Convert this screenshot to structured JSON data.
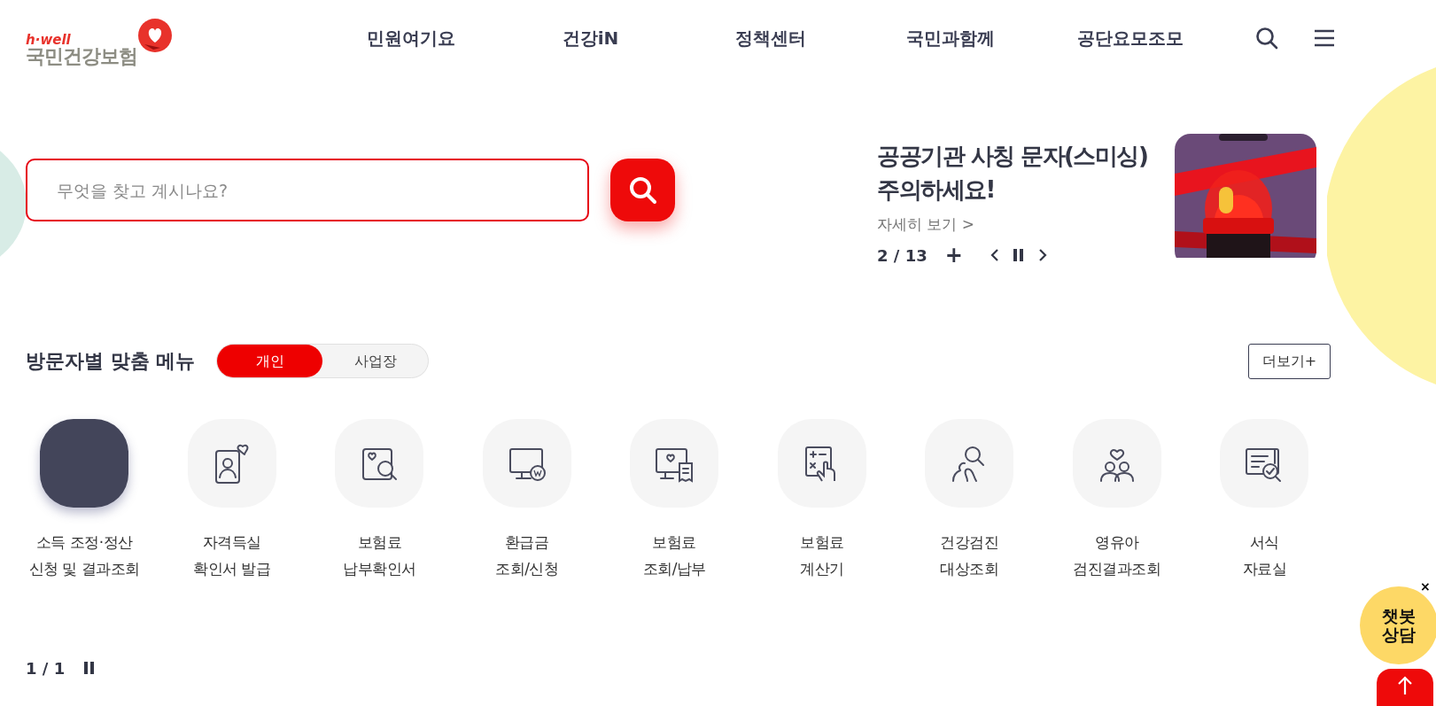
{
  "logo": {
    "tagline": "h·well",
    "name": "국민건강보험"
  },
  "nav": [
    "민원여기요",
    "건강iN",
    "정책센터",
    "국민과함께",
    "공단요모조모"
  ],
  "search": {
    "placeholder": "무엇을 찾고 계시나요?"
  },
  "banner": {
    "title": "공공기관 사칭 문자(스미싱)\n주의하세요!",
    "link": "자세히 보기 >",
    "current": "2",
    "separator": "/",
    "total": "13",
    "plus": "+"
  },
  "menu_section": {
    "title": "방문자별 맞춤 메뉴",
    "tabs": [
      {
        "label": "개인",
        "selected": true
      },
      {
        "label": "사업장",
        "selected": false
      }
    ],
    "more": "더보기+",
    "items": [
      {
        "label": "소득 조정·정산\n신청 및 결과조회",
        "selected": true
      },
      {
        "label": "자격득실\n확인서 발급",
        "selected": false
      },
      {
        "label": "보험료\n납부확인서",
        "selected": false
      },
      {
        "label": "환급금\n조회/신청",
        "selected": false
      },
      {
        "label": "보험료\n조회/납부",
        "selected": false
      },
      {
        "label": "보험료\n계산기",
        "selected": false
      },
      {
        "label": "건강검진\n대상조회",
        "selected": false
      },
      {
        "label": "영유아\n검진결과조회",
        "selected": false
      },
      {
        "label": "서식\n자료실",
        "selected": false
      }
    ],
    "pager": {
      "current": "1",
      "separator": "/",
      "total": "1"
    }
  },
  "chatbot": {
    "label": "챗봇\n상담",
    "close": "×"
  }
}
